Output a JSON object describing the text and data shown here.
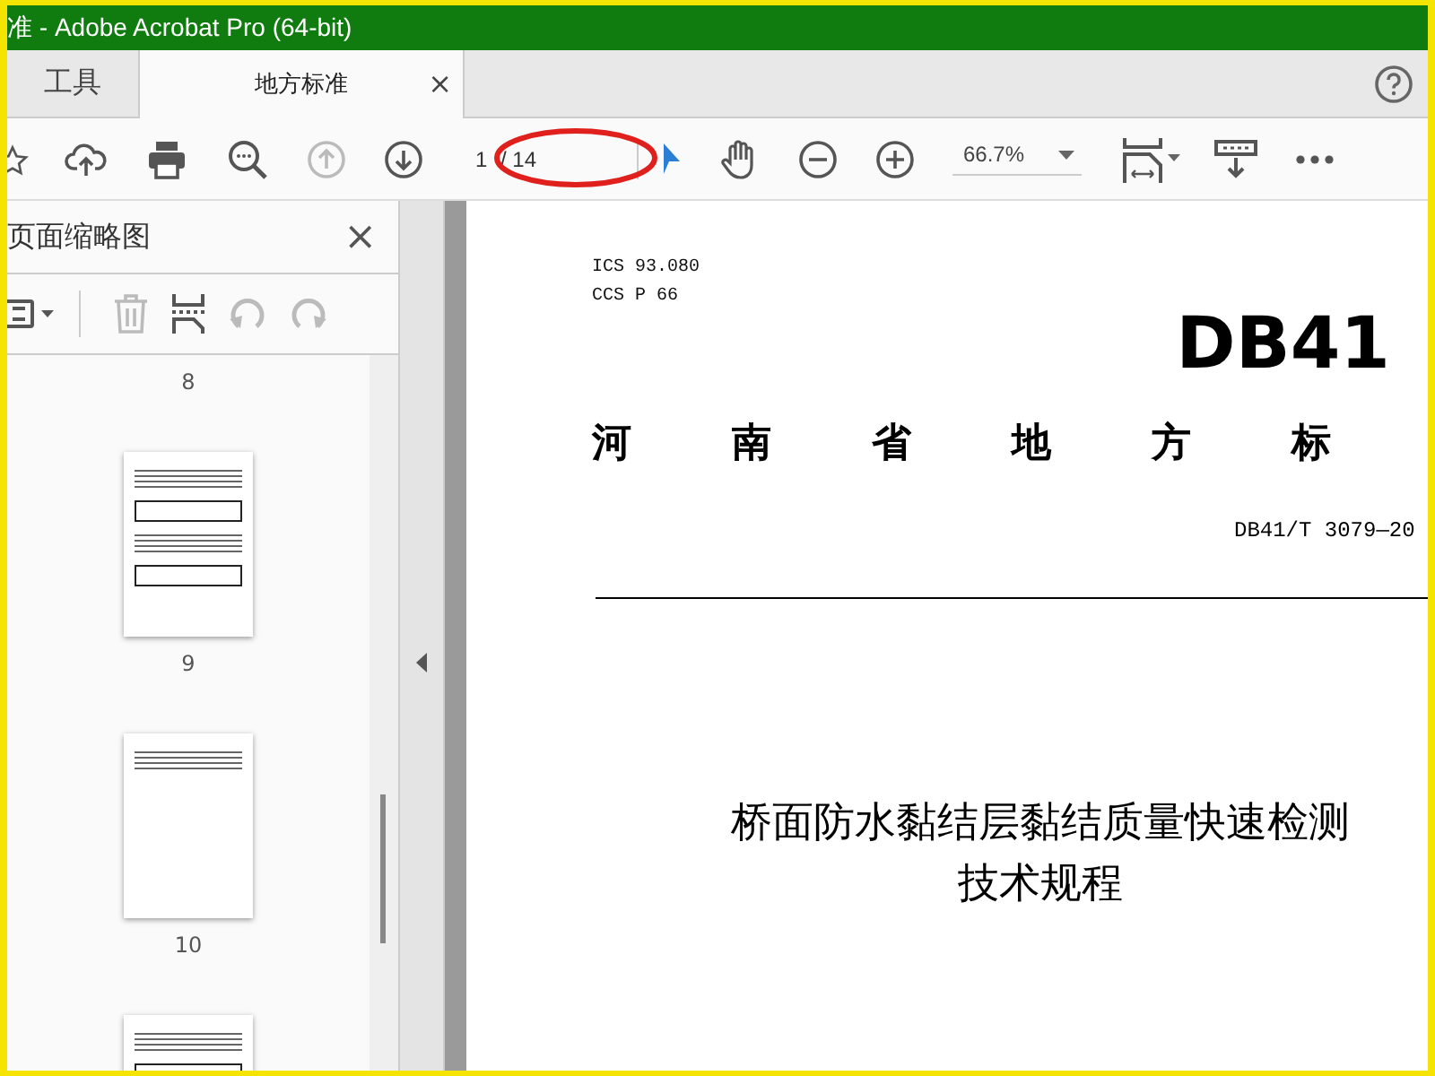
{
  "window": {
    "title": "准 - Adobe Acrobat Pro (64-bit)"
  },
  "tabs": [
    {
      "label": "工具",
      "selected": false
    },
    {
      "label": "地方标准",
      "selected": true
    }
  ],
  "tab_close": "×",
  "toolbar": {
    "page_field": {
      "value": "1"
    },
    "page_total": "/ 14",
    "zoom": "66.7%"
  },
  "sidebar": {
    "title": "页面缩略图",
    "close": "×",
    "thumbnails": [
      {
        "label": "8",
        "kind": "label_only"
      },
      {
        "label": "9",
        "kind": "table_page"
      },
      {
        "label": "10",
        "kind": "text_page"
      },
      {
        "kind": "table_page"
      }
    ]
  },
  "document": {
    "ics": "ICS  93.080",
    "ccs": "CCS  P 66",
    "code": "DB41",
    "province_heading": [
      "河",
      "南",
      "省",
      "地",
      "方",
      "标"
    ],
    "standard_number": "DB41/T 3079—20",
    "title_lines": [
      "桥面防水黏结层黏结质量快速检测",
      "技术规程"
    ]
  }
}
